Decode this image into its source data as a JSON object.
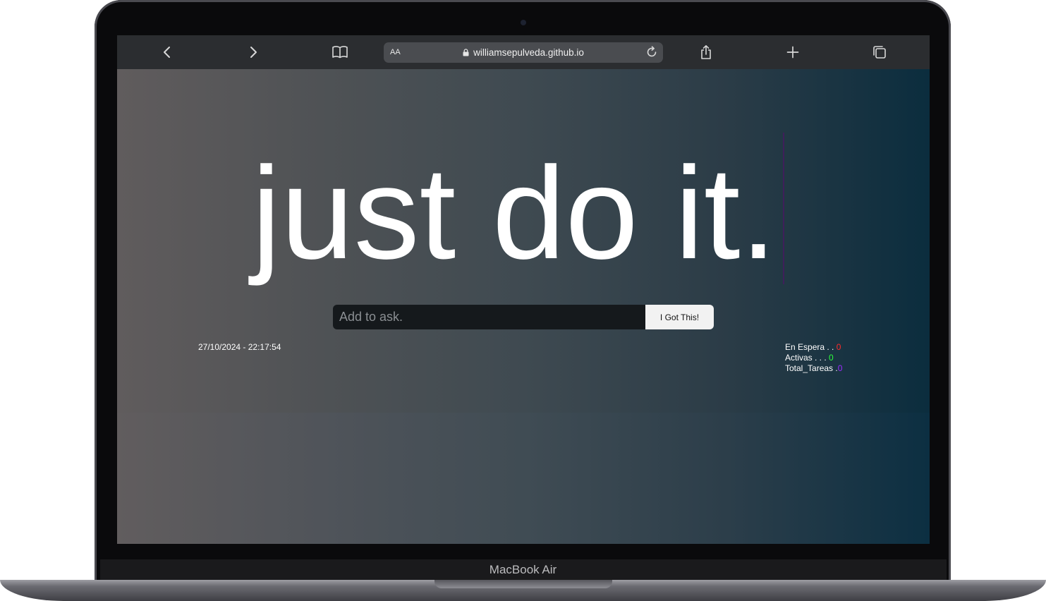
{
  "device": {
    "brand_label": "MacBook Air"
  },
  "browser": {
    "text_size_label": "AA",
    "url": "williamsepulveda.github.io",
    "icons": {
      "back": "chevron-left-icon",
      "forward": "chevron-right-icon",
      "bookmarks": "book-icon",
      "lock": "lock-icon",
      "reload": "reload-icon",
      "share": "share-icon",
      "new_tab": "plus-icon",
      "tabs": "tabs-icon"
    }
  },
  "page": {
    "title": "just do it.",
    "input_placeholder": "Add to ask.",
    "input_value": "",
    "submit_label": "I Got This!",
    "datetime": "27/10/2024 - 22:17:54",
    "stats": [
      {
        "label": "En Espera . . ",
        "value": "0",
        "color": "#ff2a2a"
      },
      {
        "label": "Activas . . . ",
        "value": "0",
        "color": "#2bff3a"
      },
      {
        "label": "Total_Tareas .",
        "value": "0",
        "color": "#9b2cff"
      }
    ]
  },
  "colors": {
    "caret": "#3f1f5a",
    "button_bg": "#f2f2f2",
    "input_bg": "#15191c"
  }
}
